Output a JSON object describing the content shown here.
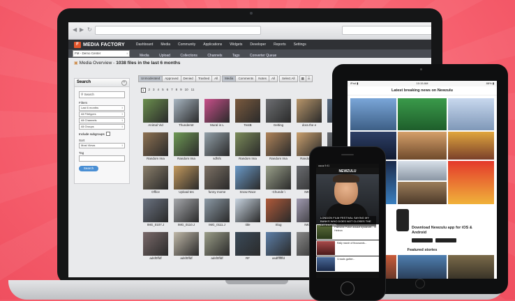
{
  "app": {
    "logo_text": "MEDIA FACTORY",
    "logo_mark": "F"
  },
  "top_nav": [
    "Dashboard",
    "Media",
    "Community",
    "Applications",
    "Widgets",
    "Developer",
    "Reports",
    "Settings"
  ],
  "site_select": "FM - Demo Center",
  "sub_nav": [
    "Media",
    "Upload",
    "Collections",
    "Channels",
    "Tags",
    "Converter Queue"
  ],
  "page_title": {
    "label": "Media Overview -",
    "count": "1038 files in the last 6 months"
  },
  "search_panel": {
    "title": "Search",
    "search_placeholder": "Search",
    "filters_label": "Filters",
    "filters": [
      "Last 6 months",
      "All Filetypes",
      "All Channels",
      "All Groups"
    ],
    "include_subgroups": "Include subgroups",
    "sort_label": "Sort",
    "sort_value": "Most Views",
    "tag_label": "Tag",
    "search_button": "Search"
  },
  "toolbar": {
    "status_tabs": [
      "Unmoderated",
      "Approved",
      "Denied",
      "Trashed",
      "All"
    ],
    "type_tabs": [
      "Media",
      "Comments",
      "Notes",
      "All"
    ],
    "select_all": "Select All"
  },
  "pager": [
    "1",
    "2",
    "3",
    "4",
    "5",
    "6",
    "7",
    "8",
    "9",
    "10",
    "11"
  ],
  "thumbnails": [
    "Animal Vid",
    "Thunderstr",
    "Mural in L",
    "TestB",
    "Gelting",
    "dora the e",
    "",
    "Random Ima",
    "Random Ima",
    "sdfsfs",
    "Random Ima",
    "Random Ima",
    "Random Ima",
    "",
    "Office",
    "Upload tes",
    "funny mome",
    "Snow Race",
    "-Chunde \\",
    "IMG_0",
    "",
    "IMG_0107.J",
    "IMG_0110.J",
    "IMG_0111.J",
    "title",
    "Slug",
    "IMG_0",
    "",
    "adsf0ffdf",
    "adsf0ffdf",
    "adsf0ffdf",
    "RF",
    "asdfffffffd",
    "",
    ""
  ],
  "thumb_colors": [
    "#6b8f4e",
    "#a8b6c2",
    "#c94f8a",
    "#7a5a3e",
    "#6d6f72",
    "#b7956a",
    "#5a6d83",
    "#8e7252",
    "#6f9a55",
    "#93a1aa",
    "#7c8c5a",
    "#b0845a",
    "#caa06e",
    "#666a70",
    "#8a7e6a",
    "#c49a5e",
    "#7d7165",
    "#6b9ac8",
    "#9aa08a",
    "#6a6c70",
    "#777",
    "#6a7280",
    "#a6a8ac",
    "#8c9aa6",
    "#c8d4e0",
    "#b05a3a",
    "#a09ab0",
    "#555",
    "#7a6a6a",
    "#c0b8a8",
    "#9b9e88",
    "#3b4b5a",
    "#5d7fa8",
    "#888",
    "#777"
  ],
  "tablet": {
    "status_left": "iPad ▮",
    "status_time": "10:15 AM",
    "status_right": "88% ▮",
    "header": "Latest breaking news on Newzulu",
    "app_promo": "Download Newzulu app for iOS & Android",
    "featured": "Featured stories"
  },
  "phone": {
    "status": "●●●● 9:41",
    "header": "NEWZULU",
    "hero_caption": "LONDON FILM FESTIVAL SAYING MY BANKS WHO DOES NOT CLOSES THE DETENTION",
    "rows": [
      "Palestine Police assault bystander... in Hebron",
      "Rally march of thousands...",
      "Crowds gather..."
    ]
  },
  "colors": {
    "accent": "#e2562c",
    "background": "#f96674",
    "search_button": "#4a8fd4"
  }
}
